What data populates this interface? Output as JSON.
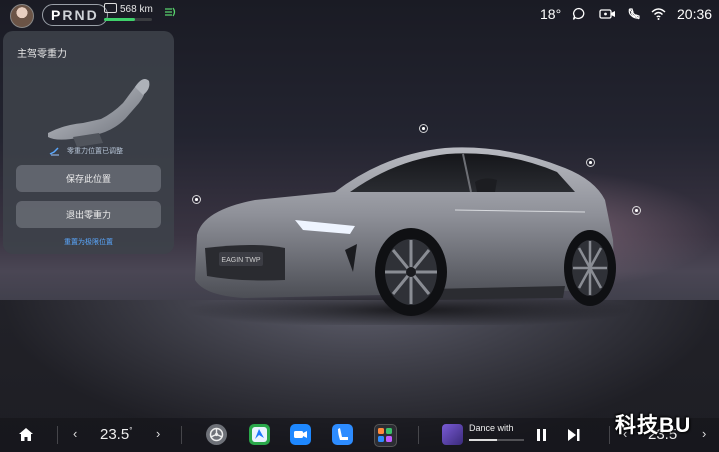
{
  "status_bar": {
    "gears": [
      "P",
      "R",
      "N",
      "D"
    ],
    "range_text": "568 km",
    "range_fraction": 0.65,
    "outside_temp": "18°",
    "time": "20:36",
    "icons": [
      "avatar",
      "battery-icon",
      "eco-mode-icon",
      "message-icon",
      "camera-icon",
      "phone-off-icon",
      "wifi-icon"
    ]
  },
  "zero_gravity_panel": {
    "title": "主驾零重力",
    "status": "零重力位置已调整",
    "save_button": "保存此位置",
    "exit_button": "退出零重力",
    "reset_link": "重置为极限位置"
  },
  "car": {
    "plate": "EAGIN TWP"
  },
  "dock": {
    "driver_temp": "23.5",
    "passenger_temp": "23.5",
    "temp_unit": "°",
    "apps": [
      "car-settings-icon",
      "navigation-app-icon",
      "camera-app-icon",
      "seat-app-icon",
      "app-drawer-icon"
    ],
    "music_title": "Dance with",
    "music_progress": 0.5
  },
  "watermark": "科技BU",
  "colors": {
    "accent_green": "#3fd16b",
    "link_blue": "#5aa8ff"
  }
}
